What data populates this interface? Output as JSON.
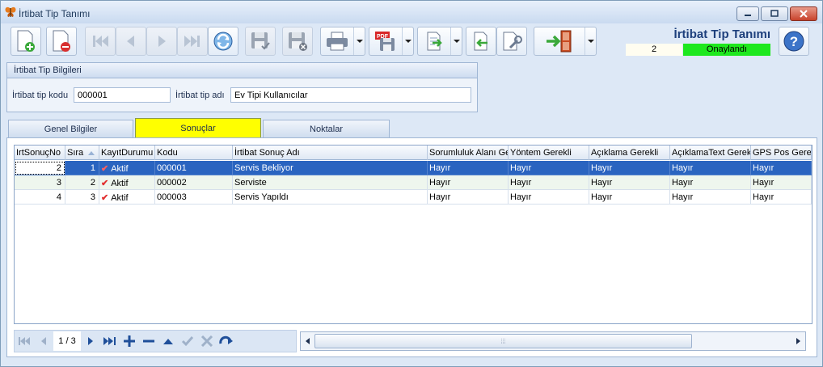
{
  "window": {
    "title": "İrtibat Tip Tanımı",
    "controls": [
      "minimize",
      "maximize",
      "close"
    ]
  },
  "toolbar": {
    "buttons": [
      {
        "name": "new-record",
        "icon": "document-add-icon"
      },
      {
        "name": "delete-record",
        "icon": "document-delete-icon"
      },
      {
        "name": "first",
        "icon": "first-record-icon"
      },
      {
        "name": "previous",
        "icon": "previous-record-icon"
      },
      {
        "name": "next",
        "icon": "next-record-icon"
      },
      {
        "name": "last",
        "icon": "last-record-icon"
      },
      {
        "name": "refresh",
        "icon": "refresh-icon"
      },
      {
        "name": "save",
        "icon": "save-icon"
      },
      {
        "name": "cancel-save",
        "icon": "save-cancel-icon"
      },
      {
        "name": "print",
        "icon": "printer-icon"
      },
      {
        "name": "export-pdf",
        "icon": "pdf-export-icon"
      },
      {
        "name": "export",
        "icon": "export-icon"
      },
      {
        "name": "import",
        "icon": "import-icon"
      },
      {
        "name": "settings",
        "icon": "wrench-icon"
      },
      {
        "name": "exit",
        "icon": "exit-door-icon"
      }
    ]
  },
  "header": {
    "form_title": "İrtibat Tip Tanımı",
    "record_count": "2",
    "status": "Onaylandı",
    "status_color": "#1ee81e",
    "help_icon": "help-icon"
  },
  "group": {
    "title": "İrtibat Tip Bilgileri",
    "code_label": "İrtibat tip kodu",
    "code_value": "000001",
    "name_label": "İrtibat tip adı",
    "name_value": "Ev Tipi Kullanıcılar"
  },
  "tabs": [
    {
      "label": "Genel Bilgiler",
      "active": false
    },
    {
      "label": "Sonuçlar",
      "active": true
    },
    {
      "label": "Noktalar",
      "active": false
    }
  ],
  "grid": {
    "columns": [
      "IrtSonuçNo",
      "Sıra",
      "KayıtDurumu",
      "Kodu",
      "İrtibat Sonuç Adı",
      "Sorumluluk Alanı Gerekli",
      "Yöntem Gerekli",
      "Açıklama Gerekli",
      "AçıklamaText Gerekli",
      "GPS Pos Gerekli"
    ],
    "sorted_column": "Sıra",
    "rows": [
      {
        "no": "2",
        "sira": "1",
        "durum": "Aktif",
        "kodu": "000001",
        "ad": "Servis Bekliyor",
        "sorumluluk": "Hayır",
        "yontem": "Hayır",
        "aciklama": "Hayır",
        "aciklama_text": "Hayır",
        "gps": "Hayır"
      },
      {
        "no": "3",
        "sira": "2",
        "durum": "Aktif",
        "kodu": "000002",
        "ad": "Serviste",
        "sorumluluk": "Hayır",
        "yontem": "Hayır",
        "aciklama": "Hayır",
        "aciklama_text": "Hayır",
        "gps": "Hayır"
      },
      {
        "no": "4",
        "sira": "3",
        "durum": "Aktif",
        "kodu": "000003",
        "ad": "Servis Yapıldı",
        "sorumluluk": "Hayır",
        "yontem": "Hayır",
        "aciklama": "Hayır",
        "aciklama_text": "Hayır",
        "gps": "Hayır"
      }
    ],
    "selected_row": 0
  },
  "navigator": {
    "position": "1 / 3"
  }
}
